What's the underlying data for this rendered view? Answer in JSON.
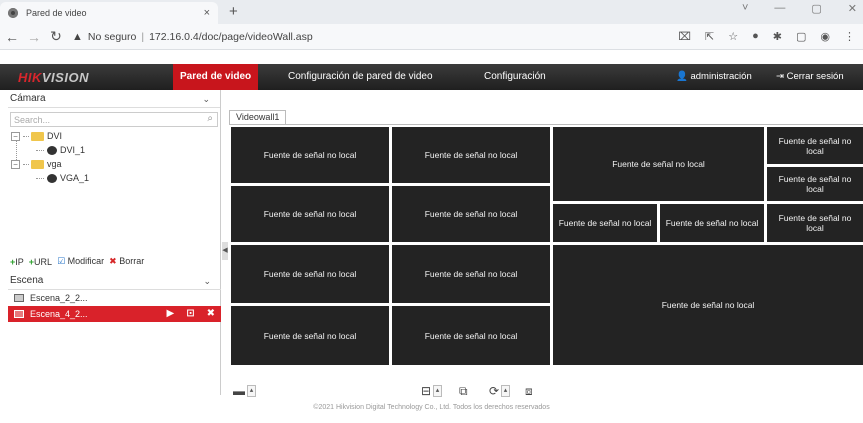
{
  "browser": {
    "tab_title": "Pared de video",
    "tab_close": "×",
    "new_tab": "+",
    "security_label": "No seguro",
    "url": "172.16.0.4/doc/page/videoWall.asp",
    "window_controls": [
      "˅",
      "—",
      "▢",
      "✕"
    ]
  },
  "header": {
    "logo_main": "HIK",
    "logo_rest": "VISION",
    "nav": [
      "Pared de video",
      "Configuración de pared de video",
      "Configuración"
    ],
    "user_label": "administración",
    "logout_label": "Cerrar sesión"
  },
  "camera_section": {
    "title": "Cámara",
    "search_placeholder": "Search...",
    "tree": [
      {
        "label": "DVI",
        "children": [
          "DVI_1"
        ]
      },
      {
        "label": "vga",
        "children": [
          "VGA_1"
        ]
      }
    ],
    "actions": {
      "ip": "IP",
      "url": "URL",
      "modify": "Modificar",
      "delete": "Borrar"
    }
  },
  "scene_section": {
    "title": "Escena",
    "scenes": [
      "Escena_2_2...",
      "Escena_4_2..."
    ],
    "selected_index": 1
  },
  "wall": {
    "tab_label": "Videowall1",
    "cell_text": "Fuente de señal no local"
  },
  "footer": {
    "text": "©2021 Hikvision Digital Technology Co., Ltd. Todos los derechos reservados"
  }
}
